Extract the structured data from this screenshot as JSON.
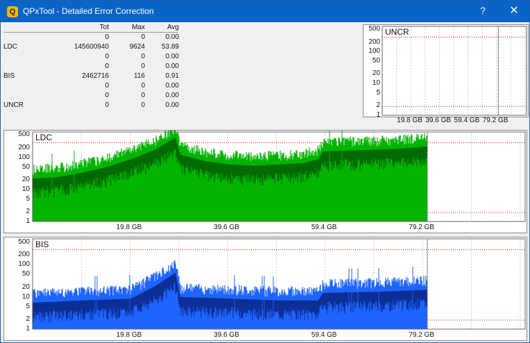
{
  "window": {
    "title": "QPxTool - Detailed Error Correction",
    "help": "?",
    "close": "✕"
  },
  "stats": {
    "headers": {
      "tot": "Tot",
      "max": "Max",
      "avg": "Avg"
    },
    "rows": [
      {
        "label": "",
        "tot": "0",
        "max": "0",
        "avg": "0.00"
      },
      {
        "label": "LDC",
        "tot": "145600940",
        "max": "9624",
        "avg": "53.89"
      },
      {
        "label": "",
        "tot": "0",
        "max": "0",
        "avg": "0.00"
      },
      {
        "label": "",
        "tot": "0",
        "max": "0",
        "avg": "0.00"
      },
      {
        "label": "BIS",
        "tot": "2462716",
        "max": "116",
        "avg": "0.91"
      },
      {
        "label": "",
        "tot": "0",
        "max": "0",
        "avg": "0.00"
      },
      {
        "label": "",
        "tot": "0",
        "max": "0",
        "avg": "0.00"
      },
      {
        "label": "UNCR",
        "tot": "0",
        "max": "0",
        "avg": "0.00"
      }
    ]
  },
  "chart_data": [
    {
      "type": "line",
      "name": "UNCR",
      "yticks": [
        "500",
        "200",
        "100",
        "50",
        "20",
        "10",
        "5",
        "2",
        "1"
      ],
      "xticks": [
        "19.8 GB",
        "39.6 GB",
        "59.4 GB",
        "79.2 GB"
      ],
      "ylim": [
        1,
        500
      ],
      "yscale": "log",
      "xlim": [
        0,
        100
      ]
    },
    {
      "type": "area",
      "name": "LDC",
      "yticks": [
        "500",
        "200",
        "100",
        "50",
        "20",
        "10",
        "5",
        "2",
        "1"
      ],
      "xticks": [
        "19.8 GB",
        "39.6 GB",
        "59.4 GB",
        "79.2 GB"
      ],
      "ylim": [
        1,
        500
      ],
      "yscale": "log",
      "xlim": [
        0,
        100
      ],
      "x": [
        0,
        5,
        10,
        15,
        20,
        25,
        29,
        30,
        35,
        40,
        45,
        50,
        55,
        58,
        59,
        65,
        70,
        75,
        80
      ],
      "y": [
        20,
        22,
        30,
        45,
        80,
        160,
        380,
        110,
        70,
        55,
        50,
        55,
        60,
        80,
        140,
        150,
        160,
        170,
        200
      ],
      "colors": {
        "outer": "#00b400",
        "inner": "#006400"
      }
    },
    {
      "type": "area",
      "name": "BIS",
      "yticks": [
        "500",
        "200",
        "100",
        "50",
        "20",
        "10",
        "5",
        "2",
        "1"
      ],
      "xticks": [
        "19.8 GB",
        "39.6 GB",
        "59.4 GB",
        "79.2 GB"
      ],
      "ylim": [
        1,
        500
      ],
      "yscale": "log",
      "xlim": [
        0,
        100
      ],
      "x": [
        0,
        10,
        20,
        25,
        29,
        30,
        40,
        50,
        58,
        59,
        70,
        80
      ],
      "y": [
        6,
        7,
        8,
        20,
        50,
        9,
        8,
        7,
        7,
        12,
        13,
        15
      ],
      "colors": {
        "outer": "#1e64ff",
        "inner": "#0a2a8c"
      }
    }
  ],
  "colors": {
    "grid": "#c8c8c8",
    "redline": "#dc0000",
    "endline": "#000000"
  }
}
